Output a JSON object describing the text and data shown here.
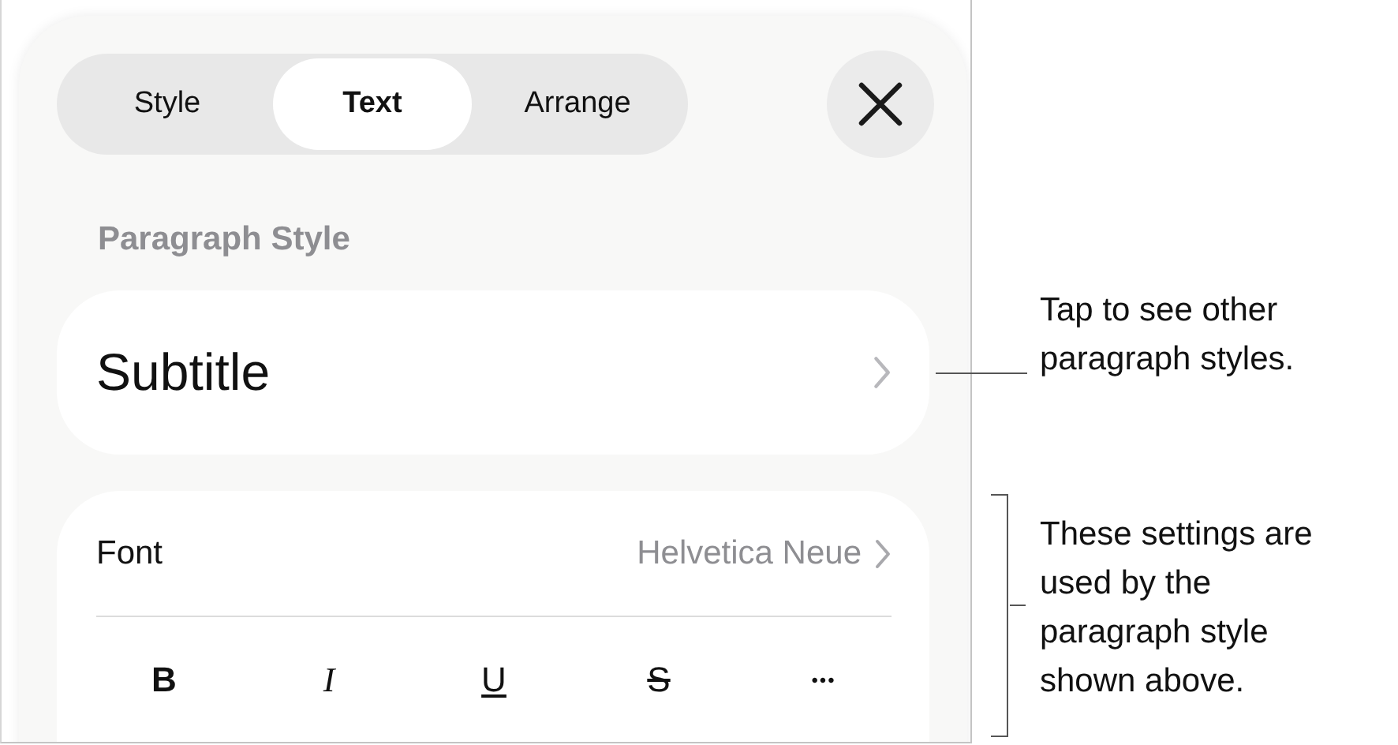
{
  "tabs": [
    {
      "label": "Style",
      "selected": false
    },
    {
      "label": "Text",
      "selected": true
    },
    {
      "label": "Arrange",
      "selected": false
    }
  ],
  "section_heading": "Paragraph Style",
  "paragraph_style": {
    "value": "Subtitle"
  },
  "font": {
    "label": "Font",
    "value": "Helvetica Neue"
  },
  "format_buttons": [
    {
      "label": "B",
      "kind": "bold"
    },
    {
      "label": "I",
      "kind": "italic"
    },
    {
      "label": "U",
      "kind": "underline"
    },
    {
      "label": "S",
      "kind": "strike"
    },
    {
      "label": "•••",
      "kind": "more"
    }
  ],
  "callouts": [
    {
      "text": "Tap to see other paragraph styles.",
      "kind": "line"
    },
    {
      "text": "These settings are used by the paragraph style shown above.",
      "kind": "bracket"
    }
  ]
}
